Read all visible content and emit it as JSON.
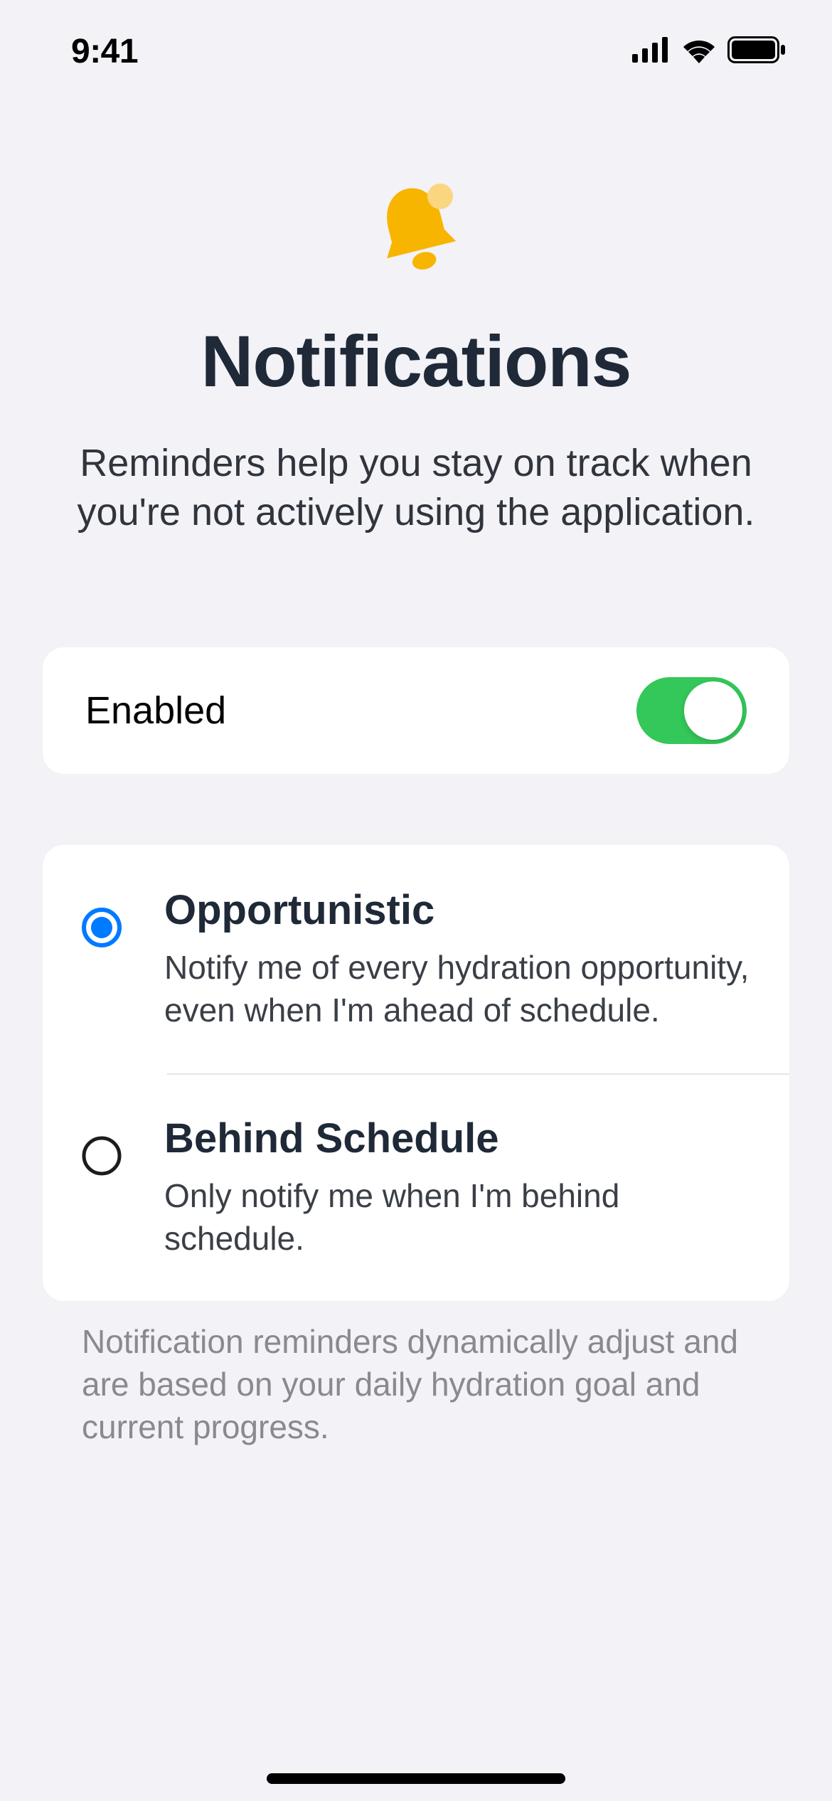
{
  "status": {
    "time": "9:41"
  },
  "header": {
    "icon": "bell-badge",
    "title": "Notifications",
    "subtitle": "Reminders help you stay on track when you're not actively using the application."
  },
  "enabled": {
    "label": "Enabled",
    "value": true
  },
  "options": [
    {
      "selected": true,
      "title": "Opportunistic",
      "description": "Notify me of every hydration opportunity, even when I'm ahead of schedule."
    },
    {
      "selected": false,
      "title": "Behind Schedule",
      "description": "Only notify me when I'm behind schedule."
    }
  ],
  "footnote": "Notification reminders dynamically adjust and are based on your daily hydration goal and current progress.",
  "colors": {
    "accent": "#f7b500",
    "switchOn": "#34c759",
    "radioSelected": "#007aff",
    "background": "#f2f2f7"
  }
}
